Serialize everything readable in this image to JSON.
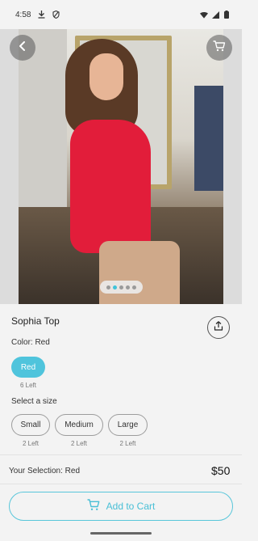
{
  "status_bar": {
    "time": "4:58",
    "left_icons": [
      "download-icon",
      "shield-icon"
    ],
    "right_icons": [
      "wifi-icon",
      "signal-icon",
      "battery-icon"
    ]
  },
  "product": {
    "name": "Sophia Top",
    "image_count": 5,
    "active_image_index": 1
  },
  "color": {
    "label": "Color: Red",
    "options": [
      {
        "name": "Red",
        "stock": "6 Left",
        "selected": true
      }
    ],
    "accent": "#4fc4dc"
  },
  "size": {
    "label": "Select a size",
    "options": [
      {
        "name": "Small",
        "stock": "2 Left"
      },
      {
        "name": "Medium",
        "stock": "2 Left"
      },
      {
        "name": "Large",
        "stock": "2 Left"
      }
    ]
  },
  "footer": {
    "selection_text": "Your Selection: Red",
    "price": "$50",
    "add_to_cart_label": "Add to Cart"
  }
}
